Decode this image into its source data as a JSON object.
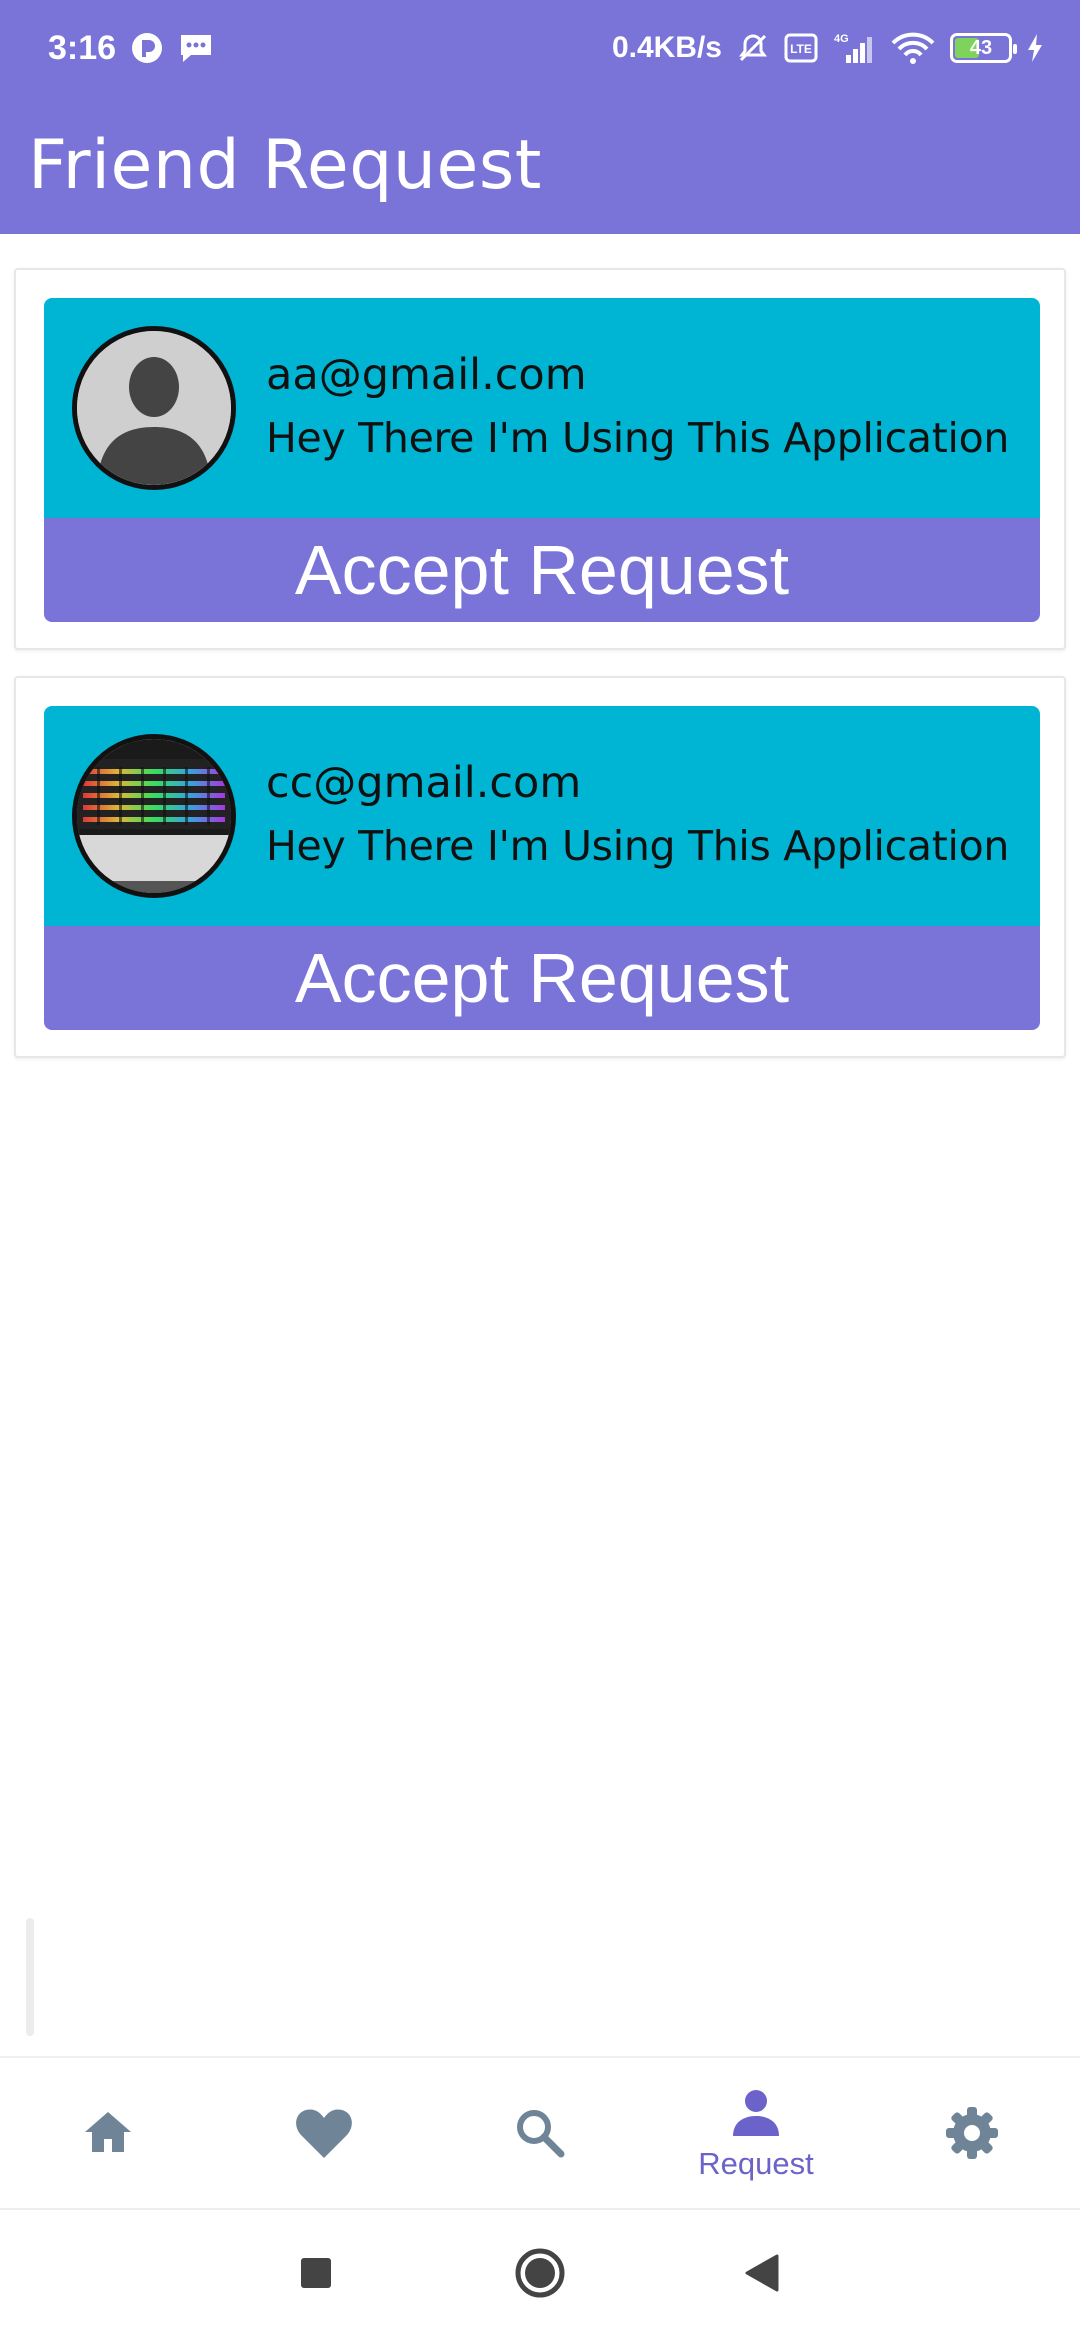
{
  "status_bar": {
    "time": "3:16",
    "speed": "0.4KB/s",
    "battery": "43",
    "network": "4G"
  },
  "app_bar": {
    "title": "Friend Request"
  },
  "requests": [
    {
      "email": "aa@gmail.com",
      "status": "Hey There I'm Using This Application",
      "accept_label": "Accept Request",
      "avatar": "default-person-icon"
    },
    {
      "email": "cc@gmail.com",
      "status": "Hey There I'm Using This Application",
      "accept_label": "Accept Request",
      "avatar": "keyboard-photo"
    }
  ],
  "bottom_nav": {
    "items": [
      {
        "name": "home",
        "icon": "home-icon",
        "label": ""
      },
      {
        "name": "favorites",
        "icon": "heart-icon",
        "label": ""
      },
      {
        "name": "search",
        "icon": "search-icon",
        "label": ""
      },
      {
        "name": "request",
        "icon": "person-icon",
        "label": "Request",
        "active": true
      },
      {
        "name": "settings",
        "icon": "gear-icon",
        "label": ""
      }
    ]
  },
  "colors": {
    "primary": "#7a73d8",
    "card_top": "#00b5d3",
    "nav_inactive": "#6f8597",
    "nav_active": "#6b63c9"
  }
}
